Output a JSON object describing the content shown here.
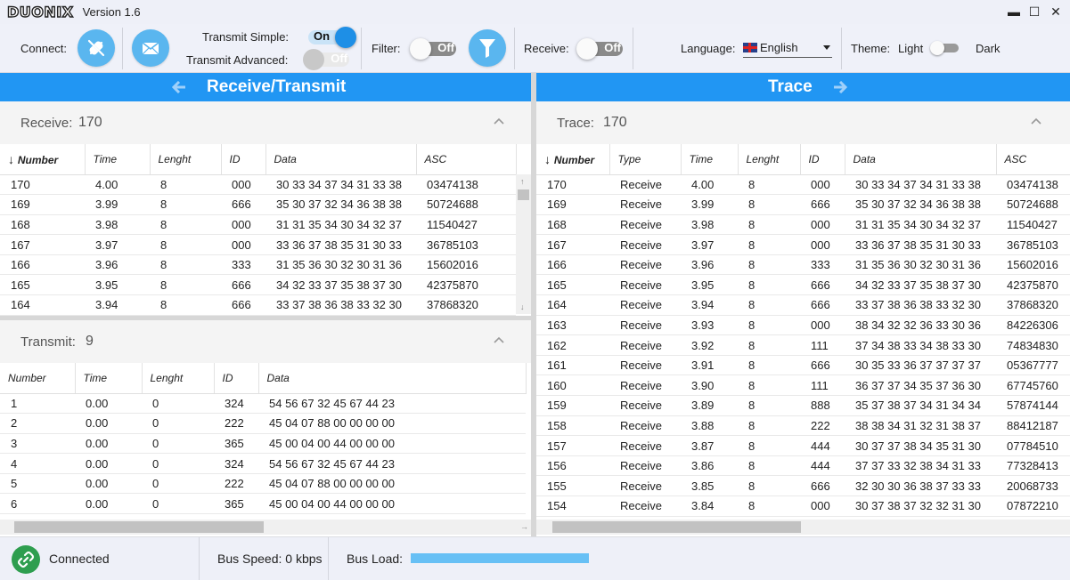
{
  "app": {
    "logo": "DUONIX",
    "version": "Version 1.6"
  },
  "window_controls": {
    "minimize": "▬",
    "maximize": "☐",
    "close": "✕"
  },
  "toolbar": {
    "connect_label": "Connect:",
    "transmit_simple_label": "Transmit Simple:",
    "transmit_simple_state": "On",
    "transmit_advanced_label": "Transmit Advanced:",
    "transmit_advanced_state": "Off",
    "filter_label": "Filter:",
    "filter_state": "Off",
    "receive_label": "Receive:",
    "receive_state": "Off",
    "language_label": "Language:",
    "language_value": "English",
    "theme_label": "Theme:",
    "theme_light": "Light",
    "theme_dark": "Dark"
  },
  "left_bar": {
    "title": "Receive/Transmit"
  },
  "right_bar": {
    "title": "Trace"
  },
  "receive": {
    "label": "Receive:",
    "count": "170",
    "columns": [
      "Number",
      "Time",
      "Lenght",
      "ID",
      "Data",
      "ASC"
    ],
    "rows": [
      [
        "170",
        "4.00",
        "8",
        "000",
        "30 33 34 37 34 31 33 38",
        "03474138"
      ],
      [
        "169",
        "3.99",
        "8",
        "666",
        "35 30 37 32 34 36 38 38",
        "50724688"
      ],
      [
        "168",
        "3.98",
        "8",
        "000",
        "31 31 35 34 30 34 32 37",
        "11540427"
      ],
      [
        "167",
        "3.97",
        "8",
        "000",
        "33 36 37 38 35 31 30 33",
        "36785103"
      ],
      [
        "166",
        "3.96",
        "8",
        "333",
        "31 35 36 30 32 30 31 36",
        "15602016"
      ],
      [
        "165",
        "3.95",
        "8",
        "666",
        "34 32 33 37 35 38 37 30",
        "42375870"
      ],
      [
        "164",
        "3.94",
        "8",
        "666",
        "33 37 38 36 38 33 32 30",
        "37868320"
      ]
    ]
  },
  "transmit": {
    "label": "Transmit:",
    "count": "9",
    "columns": [
      "Number",
      "Time",
      "Lenght",
      "ID",
      "Data"
    ],
    "rows": [
      [
        "1",
        "0.00",
        "0",
        "324",
        "54 56 67 32 45 67 44 23"
      ],
      [
        "2",
        "0.00",
        "0",
        "222",
        "45 04 07 88 00 00 00 00"
      ],
      [
        "3",
        "0.00",
        "0",
        "365",
        "45 00 04 00 44 00 00 00"
      ],
      [
        "4",
        "0.00",
        "0",
        "324",
        "54 56 67 32 45 67 44 23"
      ],
      [
        "5",
        "0.00",
        "0",
        "222",
        "45 04 07 88 00 00 00 00"
      ],
      [
        "6",
        "0.00",
        "0",
        "365",
        "45 00 04 00 44 00 00 00"
      ]
    ]
  },
  "trace": {
    "label": "Trace:",
    "count": "170",
    "columns": [
      "Number",
      "Type",
      "Time",
      "Lenght",
      "ID",
      "Data",
      "ASC"
    ],
    "rows": [
      [
        "170",
        "Receive",
        "4.00",
        "8",
        "000",
        "30 33 34 37 34 31 33 38",
        "03474138"
      ],
      [
        "169",
        "Receive",
        "3.99",
        "8",
        "666",
        "35 30 37 32 34 36 38 38",
        "50724688"
      ],
      [
        "168",
        "Receive",
        "3.98",
        "8",
        "000",
        "31 31 35 34 30 34 32 37",
        "11540427"
      ],
      [
        "167",
        "Receive",
        "3.97",
        "8",
        "000",
        "33 36 37 38 35 31 30 33",
        "36785103"
      ],
      [
        "166",
        "Receive",
        "3.96",
        "8",
        "333",
        "31 35 36 30 32 30 31 36",
        "15602016"
      ],
      [
        "165",
        "Receive",
        "3.95",
        "8",
        "666",
        "34 32 33 37 35 38 37 30",
        "42375870"
      ],
      [
        "164",
        "Receive",
        "3.94",
        "8",
        "666",
        "33 37 38 36 38 33 32 30",
        "37868320"
      ],
      [
        "163",
        "Receive",
        "3.93",
        "8",
        "000",
        "38 34 32 32 36 33 30 36",
        "84226306"
      ],
      [
        "162",
        "Receive",
        "3.92",
        "8",
        "111",
        "37 34 38 33 34 38 33 30",
        "74834830"
      ],
      [
        "161",
        "Receive",
        "3.91",
        "8",
        "666",
        "30 35 33 36 37 37 37 37",
        "05367777"
      ],
      [
        "160",
        "Receive",
        "3.90",
        "8",
        "111",
        "36 37 37 34 35 37 36 30",
        "67745760"
      ],
      [
        "159",
        "Receive",
        "3.89",
        "8",
        "888",
        "35 37 38 37 34 31 34 34",
        "57874144"
      ],
      [
        "158",
        "Receive",
        "3.88",
        "8",
        "222",
        "38 38 34 31 32 31 38 37",
        "88412187"
      ],
      [
        "157",
        "Receive",
        "3.87",
        "8",
        "444",
        "30 37 37 38 34 35 31 30",
        "07784510"
      ],
      [
        "156",
        "Receive",
        "3.86",
        "8",
        "444",
        "37 37 33 32 38 34 31 33",
        "77328413"
      ],
      [
        "155",
        "Receive",
        "3.85",
        "8",
        "666",
        "32 30 30 36 38 37 33 33",
        "20068733"
      ],
      [
        "154",
        "Receive",
        "3.84",
        "8",
        "000",
        "30 37 38 37 32 32 31 30",
        "07872210"
      ]
    ]
  },
  "status": {
    "connection": "Connected",
    "bus_speed": "Bus Speed: 0 kbps",
    "bus_load_label": "Bus Load:",
    "bus_load_fraction": 1.0
  },
  "colors": {
    "accent": "#2196f3",
    "button": "#5ab6ef",
    "connected": "#2e9e4f",
    "busload": "#67c0f5"
  },
  "icons": [
    "plug-icon",
    "mail-icon",
    "filter-icon",
    "link-icon",
    "arrow-left-icon",
    "arrow-right-icon",
    "chevron-up-icon",
    "sort-down-icon"
  ]
}
